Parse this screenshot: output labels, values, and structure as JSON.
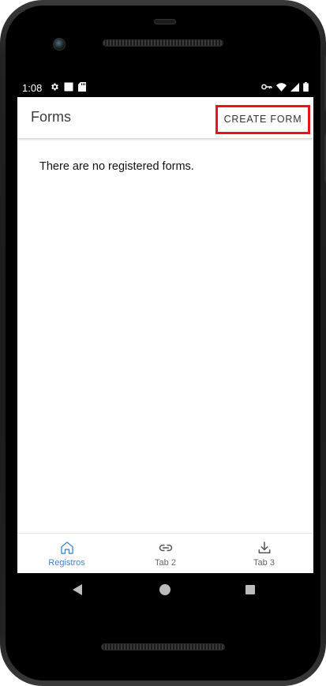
{
  "status_bar": {
    "time": "1:08",
    "left_icons": [
      "gear-icon",
      "square-icon",
      "sd-card-icon"
    ],
    "right_icons": [
      "vpn-key-icon",
      "wifi-icon",
      "signal-icon",
      "battery-icon"
    ]
  },
  "app_bar": {
    "title": "Forms",
    "action_label": "CREATE FORM",
    "highlight_color": "#e8131b"
  },
  "main": {
    "empty_message": "There are no registered forms."
  },
  "bottom_nav": {
    "active_color": "#3d86d2",
    "items": [
      {
        "label": "Registros",
        "icon": "home-icon",
        "active": true
      },
      {
        "label": "Tab 2",
        "icon": "link-icon",
        "active": false
      },
      {
        "label": "Tab 3",
        "icon": "download-icon",
        "active": false
      }
    ]
  },
  "system_nav": {
    "buttons": [
      "back-icon",
      "home-circle-icon",
      "recents-icon"
    ]
  }
}
